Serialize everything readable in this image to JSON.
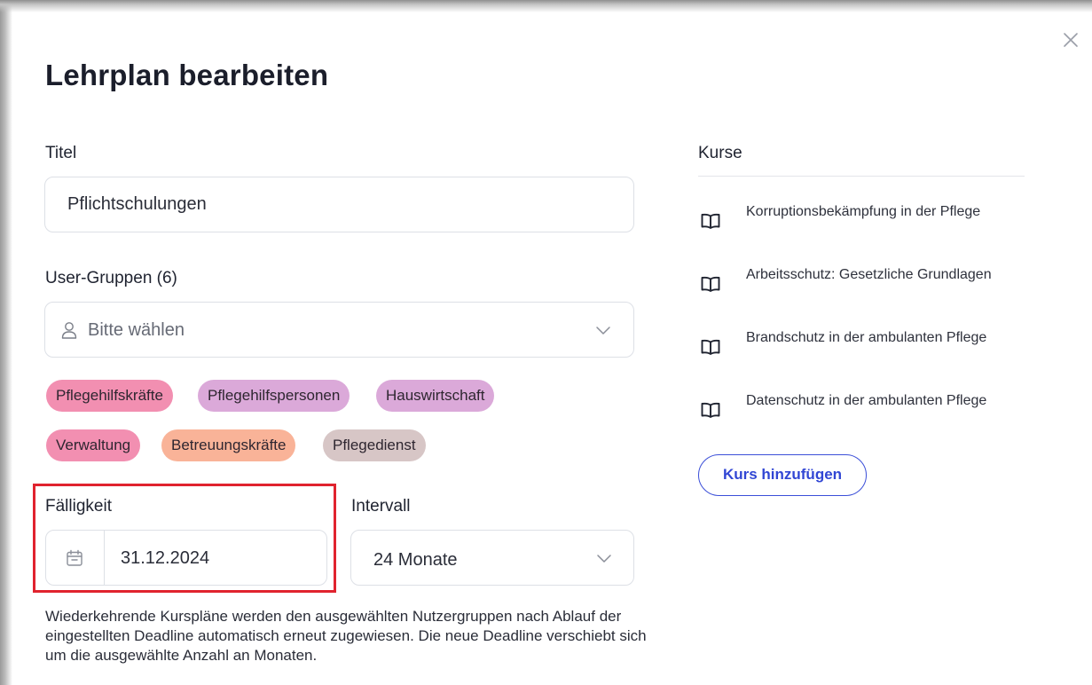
{
  "dialog": {
    "title": "Lehrplan bearbeiten",
    "close_icon": "close-icon"
  },
  "form": {
    "title_label": "Titel",
    "title_value": "Pflichtschulungen",
    "groups_label": "User-Gruppen (6)",
    "groups_placeholder": "Bitte wählen",
    "groups_icon": "user-icon",
    "tags": [
      {
        "label": "Pflegehilfskräfte",
        "color": "#f28fb1"
      },
      {
        "label": "Pflegehilfspersonen",
        "color": "#dba9d9"
      },
      {
        "label": "Hauswirtschaft",
        "color": "#dba9d9"
      },
      {
        "label": "Verwaltung",
        "color": "#f28fb1"
      },
      {
        "label": "Betreuungskräfte",
        "color": "#f9b398"
      },
      {
        "label": "Pflegedienst",
        "color": "#d7c6c6"
      }
    ],
    "due_label": "Fälligkeit",
    "due_value": "31.12.2024",
    "due_icon": "calendar-icon",
    "interval_label": "Intervall",
    "interval_value": "24 Monate",
    "description": "Wiederkehrende Kurspläne werden den ausgewählten Nutzergruppen nach Ablauf der eingestellten Deadline automatisch erneut zugewiesen. Die neue Deadline verschiebt sich um die ausgewählte Anzahl an Monaten."
  },
  "courses": {
    "label": "Kurse",
    "items": [
      {
        "title": "Korruptionsbekämpfung in der Pflege",
        "icon": "book-icon"
      },
      {
        "title": "Arbeitsschutz: Gesetzliche Grundlagen",
        "icon": "book-icon"
      },
      {
        "title": "Brandschutz in der ambulanten Pflege",
        "icon": "book-icon"
      },
      {
        "title": "Datenschutz in der ambulanten Pflege",
        "icon": "book-icon"
      }
    ],
    "add_button": "Kurs hinzufügen"
  },
  "colors": {
    "accent": "#3146d4",
    "highlight": "#e0232e"
  }
}
